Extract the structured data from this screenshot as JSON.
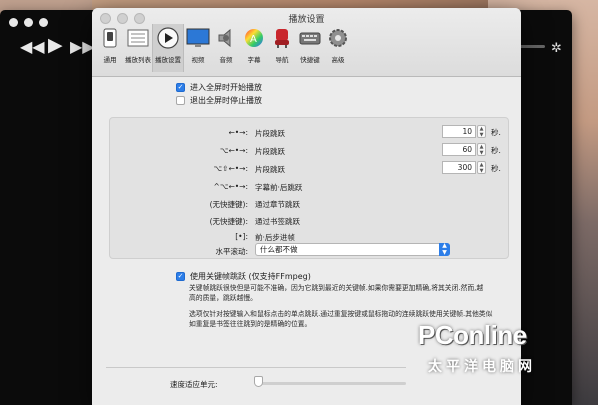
{
  "window": {
    "title": "播放设置"
  },
  "toolbar": {
    "items": [
      {
        "label": "通用",
        "icon": "switch-icon"
      },
      {
        "label": "播放列表",
        "icon": "playlist-icon"
      },
      {
        "label": "播放设置",
        "icon": "play-icon",
        "selected": true
      },
      {
        "label": "视频",
        "icon": "monitor-icon"
      },
      {
        "label": "音频",
        "icon": "speaker-icon"
      },
      {
        "label": "字幕",
        "icon": "color-wheel-icon"
      },
      {
        "label": "导航",
        "icon": "seat-icon"
      },
      {
        "label": "快捷键",
        "icon": "keyboard-icon"
      },
      {
        "label": "高级",
        "icon": "gear-icon"
      }
    ]
  },
  "fullscreen": {
    "start_label": "进入全屏时开始播放",
    "start_checked": true,
    "stop_label": "退出全屏时停止播放",
    "stop_checked": false
  },
  "seek": {
    "rows": [
      {
        "shortcut": "←•→:",
        "desc": "片段跳跃",
        "value": "10",
        "unit": "秒."
      },
      {
        "shortcut": "⌥←•→:",
        "desc": "片段跳跃",
        "value": "60",
        "unit": "秒."
      },
      {
        "shortcut": "⌥⇧←•→:",
        "desc": "片段跳跃",
        "value": "300",
        "unit": "秒."
      },
      {
        "shortcut": "^⌥←•→:",
        "desc": "字幕前·后跳跃"
      },
      {
        "shortcut": "(无快捷键):",
        "desc": "通过章节跳跃"
      },
      {
        "shortcut": "(无快捷键):",
        "desc": "通过书签跳跃"
      },
      {
        "shortcut": "[•]:",
        "desc": "前·后步进帧"
      }
    ],
    "scroll_label": "水平滚动:",
    "scroll_value": "什么都不做"
  },
  "keyframe": {
    "label": "使用关键帧跳跃 (仅支持FFmpeg)",
    "checked": true,
    "desc1": "关键帧跳跃很快但是可能不准确，因为它跳到最近的关键帧.如果你需要更加精确,将其关闭.然而,越高的质量，跳跃越慢。",
    "desc2": "选项仅针对按键输入和鼠标点击的单点跳跃.通过重复按键或鼠标拖动的连续跳跃使用关键帧.其他类似如重复是书签往往跳到的是精确的位置。"
  },
  "speed": {
    "label": "速度适应单元:",
    "level": 0
  },
  "watermark": {
    "logo": "PConline",
    "sub": "太平洋电脑网"
  }
}
